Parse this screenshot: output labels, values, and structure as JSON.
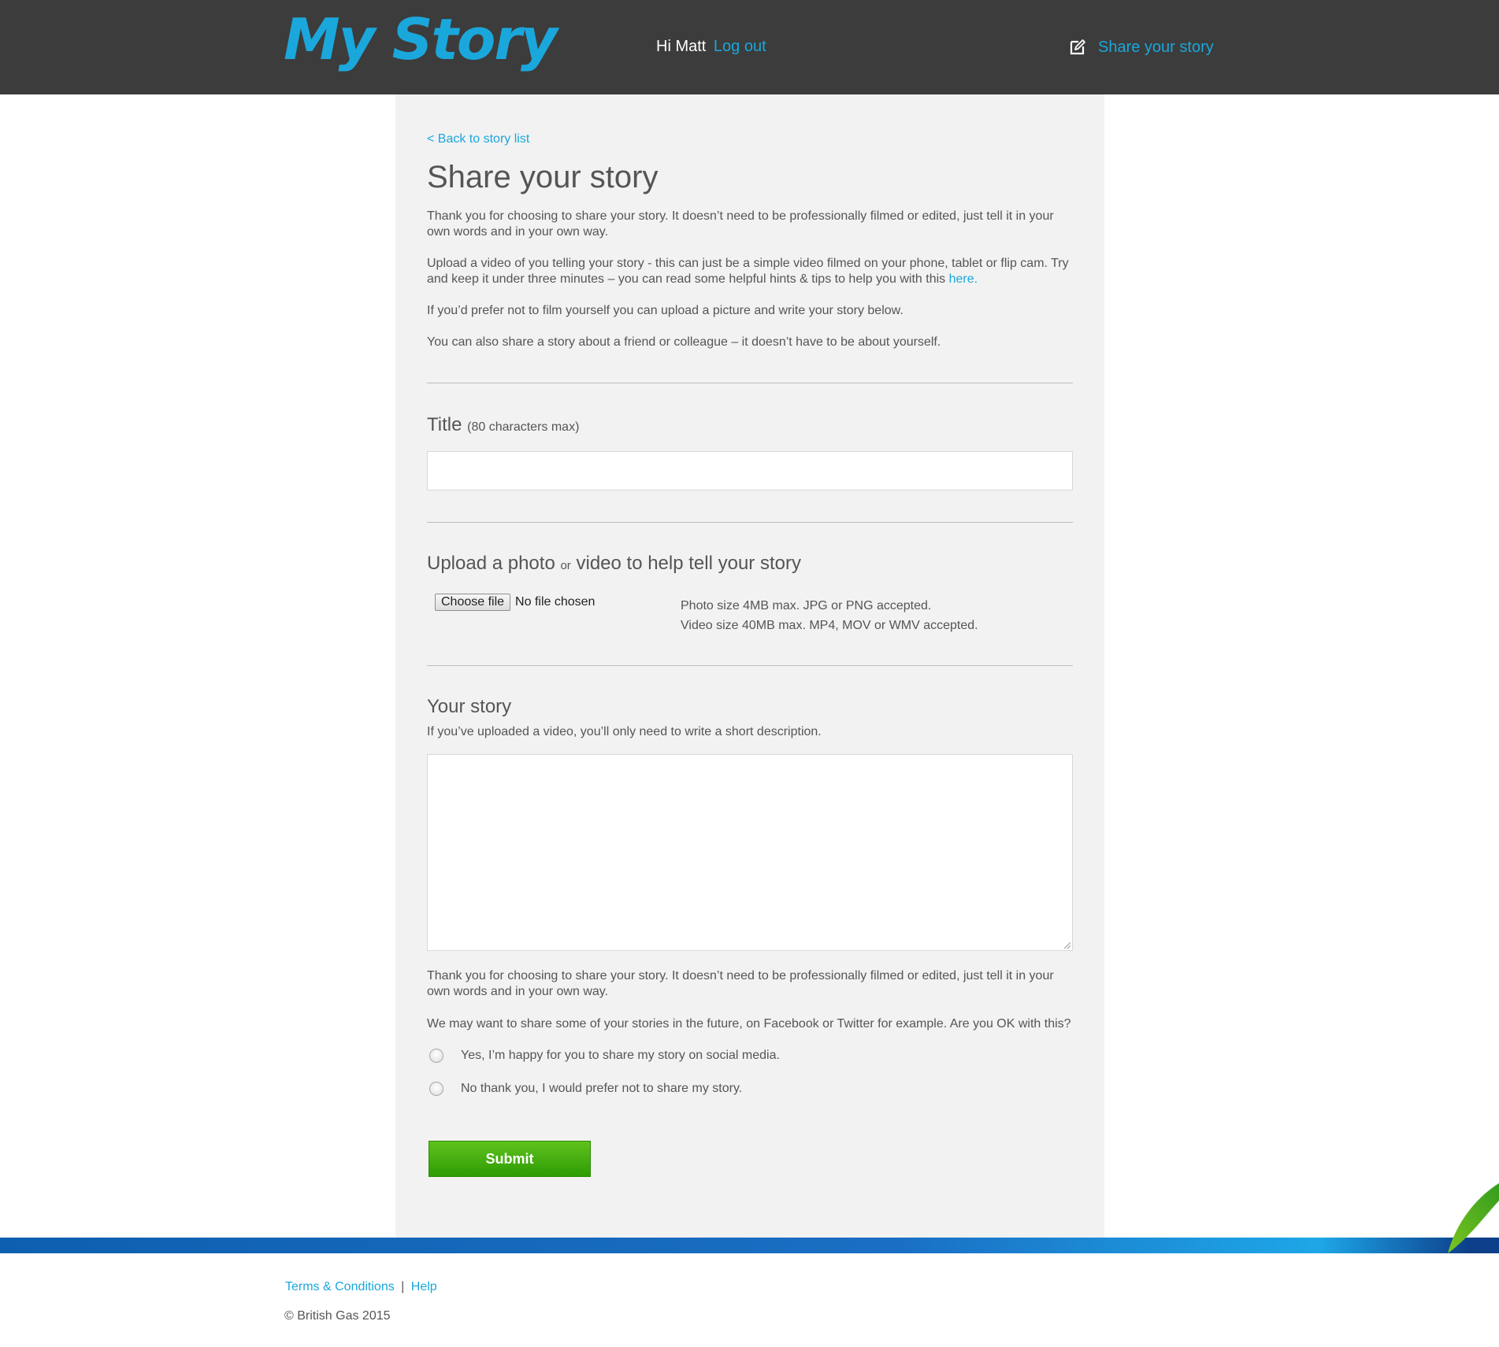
{
  "header": {
    "logo_text": "My Story",
    "greeting": "Hi Matt",
    "logout_label": "Log out",
    "share_label": "Share your story",
    "share_icon": "edit-icon",
    "brand_color": "#1aa7dc"
  },
  "main": {
    "back_link": "< Back to story list",
    "title": "Share your story",
    "intro": [
      "Thank you for choosing to share your story. It doesn’t need to be professionally filmed or edited, just tell it in your own words and in your own way.",
      "Upload a video of you telling your story - this can just be a simple video filmed on your phone, tablet or flip cam. Try and keep it under three minutes – you can read some helpful hints & tips to help you with this",
      "If you’d prefer not to film yourself you can upload a picture and write your story below.",
      "You can also share a story about a friend or colleague – it doesn’t have to be about yourself."
    ],
    "here_link": "here.",
    "title_field": {
      "label": "Title",
      "hint": "(80 characters max)",
      "value": ""
    },
    "upload": {
      "label_part1": "Upload a photo",
      "label_or": "or",
      "label_part2": "video to help tell your story",
      "button_label": "Choose file",
      "status": "No file chosen",
      "photo_info": "Photo size 4MB max. JPG or PNG accepted.",
      "video_info": "Video size 40MB max. MP4, MOV or WMV accepted."
    },
    "story": {
      "label": "Your story",
      "subtitle": "If you’ve uploaded a video, you’ll only need to write a short description.",
      "value": ""
    },
    "closing_text": "Thank you for choosing to share your story. It doesn’t need to be professionally filmed or edited, just tell it in your own words and in your own way.",
    "share_question": "We may want to share some of your stories in the future, on Facebook or Twitter for example. Are you OK with this?",
    "options": [
      {
        "label": "Yes, I’m happy for you to share my story on social media.",
        "selected": false
      },
      {
        "label": "No thank you, I would prefer not to share my story.",
        "selected": false
      }
    ],
    "submit_label": "Submit",
    "submit_color": "#3fa90c"
  },
  "footer": {
    "terms_label": "Terms & Conditions",
    "separator": "|",
    "help_label": "Help",
    "copyright": "© British Gas 2015"
  }
}
